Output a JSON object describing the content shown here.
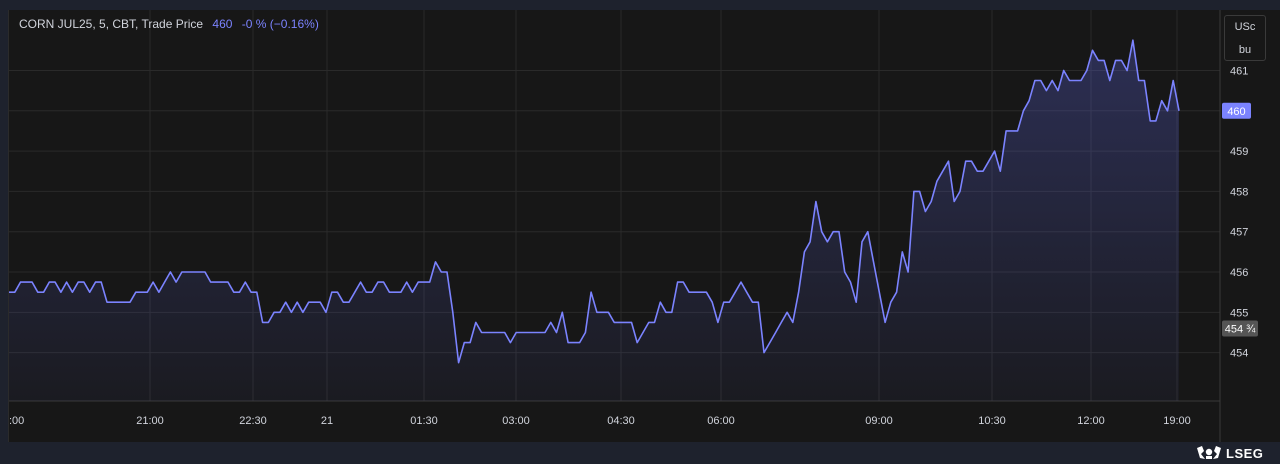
{
  "legend": {
    "instrument": "CORN JUL25, 5, CBT, Trade Price",
    "last": "460",
    "change": "-0 % (−0.16%)"
  },
  "unit": {
    "line1": "USc",
    "line2": "bu"
  },
  "brand": {
    "name": "LSEG",
    "icon": "lseg-logo-icon"
  },
  "colors": {
    "line": "#7b83ff",
    "background": "#171717",
    "frame": "#1e222d",
    "grid": "#2a2a2a"
  },
  "chart_data": {
    "type": "area",
    "title": "",
    "xlabel": "",
    "ylabel": "",
    "ylim": [
      452.8,
      462.5
    ],
    "grid": true,
    "y_ticks": [
      454,
      455,
      456,
      457,
      458,
      459,
      460,
      461
    ],
    "x_ticks": [
      ":00",
      "21:00",
      "22:30",
      "21",
      "01:30",
      "03:00",
      "04:30",
      "06:00",
      "09:00",
      "10:30",
      "12:00",
      "19:00"
    ],
    "last_price_label": "460",
    "previous_close_label": "454 ¾",
    "previous_close": 454.6,
    "series": [
      {
        "values": [
          455.5,
          455.5,
          455.75,
          455.75,
          455.75,
          455.5,
          455.5,
          455.75,
          455.75,
          455.5,
          455.75,
          455.5,
          455.75,
          455.75,
          455.5,
          455.75,
          455.75,
          455.25,
          455.25,
          455.25,
          455.25,
          455.25,
          455.5,
          455.5,
          455.5,
          455.75,
          455.5,
          455.75,
          456,
          455.75,
          456,
          456,
          456,
          456,
          456,
          455.75,
          455.75,
          455.75,
          455.75,
          455.5,
          455.5,
          455.75,
          455.5,
          455.5,
          454.75,
          454.75,
          455,
          455,
          455.25,
          455,
          455.25,
          455,
          455.25,
          455.25,
          455.25,
          455,
          455.5,
          455.5,
          455.25,
          455.25,
          455.5,
          455.75,
          455.5,
          455.5,
          455.75,
          455.75,
          455.5,
          455.5,
          455.5,
          455.75,
          455.5,
          455.75,
          455.75,
          455.75,
          456.25,
          456,
          456,
          455,
          453.75,
          454.25,
          454.25,
          454.75,
          454.5,
          454.5,
          454.5,
          454.5,
          454.5,
          454.25,
          454.5,
          454.5,
          454.5,
          454.5,
          454.5,
          454.5,
          454.75,
          454.5,
          455,
          454.25,
          454.25,
          454.25,
          454.5,
          455.5,
          455,
          455,
          455,
          454.75,
          454.75,
          454.75,
          454.75,
          454.25,
          454.5,
          454.75,
          454.75,
          455.25,
          455,
          455,
          455.75,
          455.75,
          455.5,
          455.5,
          455.5,
          455.5,
          455.25,
          454.75,
          455.25,
          455.25,
          455.5,
          455.75,
          455.5,
          455.25,
          455.25,
          454,
          454.25,
          454.5,
          454.75,
          455,
          454.75,
          455.5,
          456.5,
          456.75,
          457.75,
          457,
          456.75,
          457,
          457,
          456,
          455.75,
          455.25,
          456.75,
          457,
          456.25,
          455.5,
          454.75,
          455.25,
          455.5,
          456.5,
          456,
          458,
          458,
          457.5,
          457.75,
          458.25,
          458.5,
          458.75,
          457.75,
          458,
          458.75,
          458.75,
          458.5,
          458.5,
          458.75,
          459,
          458.5,
          459.5,
          459.5,
          459.5,
          460,
          460.25,
          460.75,
          460.75,
          460.5,
          460.75,
          460.5,
          461,
          460.75,
          460.75,
          460.75,
          461,
          461.5,
          461.25,
          461.25,
          460.75,
          461.25,
          461.25,
          461,
          461.75,
          460.75,
          460.75,
          459.75,
          459.75,
          460.25,
          460,
          460.75,
          460
        ]
      }
    ]
  }
}
